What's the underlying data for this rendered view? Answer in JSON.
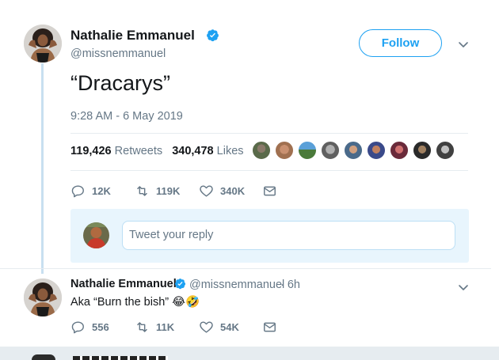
{
  "main_tweet": {
    "author_name": "Nathalie Emmanuel",
    "author_handle": "@missnemmanuel",
    "follow_label": "Follow",
    "text": "“Dracarys”",
    "timestamp": "9:28 AM - 6 May 2019",
    "retweets_count": "119,426",
    "retweets_label": "Retweets",
    "likes_count": "340,478",
    "likes_label": "Likes",
    "actions": {
      "reply_count": "12K",
      "retweet_count": "119K",
      "like_count": "340K"
    }
  },
  "reply_composer": {
    "placeholder": "Tweet your reply"
  },
  "reply_tweet": {
    "author_name": "Nathalie Emmanuel",
    "author_handle": "@missnemmanuel",
    "time_ago": "· 6h",
    "text": "Aka “Burn the bish” 😂🤣",
    "actions": {
      "reply_count": "556",
      "retweet_count": "11K",
      "like_count": "54K"
    }
  },
  "colors": {
    "accent": "#1da1f2",
    "secondary_text": "#657786",
    "thread_line": "#c8dff0"
  }
}
